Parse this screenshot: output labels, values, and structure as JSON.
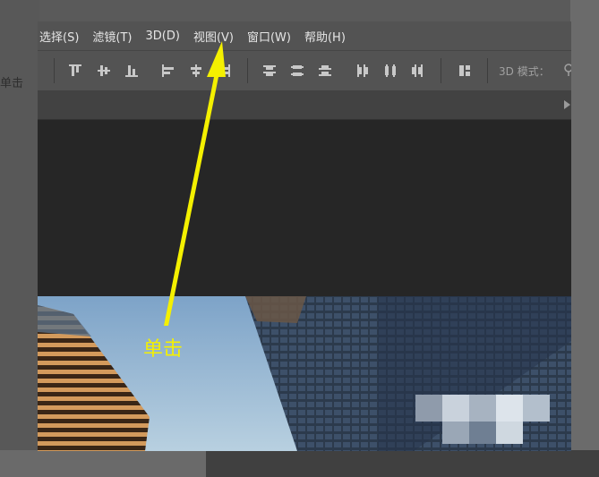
{
  "menubar": {
    "items": [
      {
        "label": "选择(S)"
      },
      {
        "label": "滤镜(T)"
      },
      {
        "label": "3D(D)"
      },
      {
        "label": "视图(V)"
      },
      {
        "label": "窗口(W)"
      },
      {
        "label": "帮助(H)"
      }
    ]
  },
  "optionsbar": {
    "mode_label": "3D 模式：",
    "tools": [
      "align-top-edges-icon",
      "align-vertical-centers-icon",
      "align-bottom-edges-icon",
      "align-left-edges-icon",
      "align-horizontal-centers-icon",
      "align-right-edges-icon",
      "distribute-top-edges-icon",
      "distribute-vertical-centers-icon",
      "distribute-bottom-edges-icon",
      "distribute-left-edges-icon",
      "distribute-horizontal-centers-icon",
      "distribute-right-edges-icon",
      "auto-align-layers-icon"
    ]
  },
  "background": {
    "partial_text": "单击"
  },
  "annotation": {
    "text": "单击",
    "color": "#f4f000",
    "target": "视图(V)"
  },
  "colors": {
    "menubar": "#535353",
    "canvas": "#262626",
    "menu_text": "#e6e6e6"
  }
}
